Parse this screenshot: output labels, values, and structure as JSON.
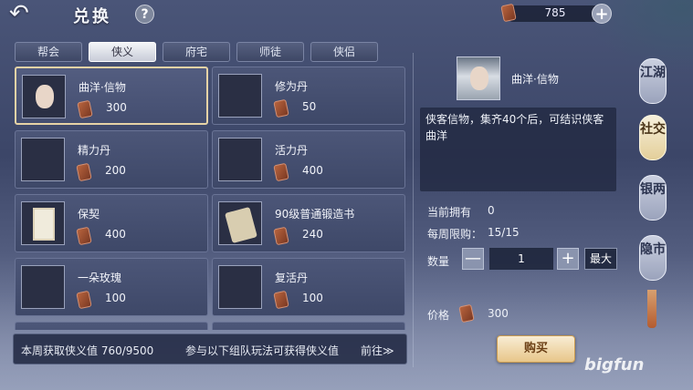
{
  "header": {
    "back_glyph": "↶",
    "title": "兑换",
    "help_glyph": "?",
    "currency_amount": "785",
    "add_glyph": "+"
  },
  "tabs": [
    {
      "label": "帮会",
      "active": false
    },
    {
      "label": "侠义",
      "active": true
    },
    {
      "label": "府宅",
      "active": false
    },
    {
      "label": "师徒",
      "active": false
    },
    {
      "label": "侠侣",
      "active": false
    }
  ],
  "items": [
    {
      "name": "曲洋·信物",
      "price": "300",
      "icon": "portrait-icon",
      "selected": true
    },
    {
      "name": "修为丹",
      "price": "50",
      "icon": "purple-orb-icon"
    },
    {
      "name": "精力丹",
      "price": "200",
      "icon": "red-orb-icon"
    },
    {
      "name": "活力丹",
      "price": "400",
      "icon": "blue-orb-icon"
    },
    {
      "name": "保契",
      "price": "400",
      "icon": "contract-paper-icon"
    },
    {
      "name": "90级普通锻造书",
      "price": "240",
      "icon": "scroll-icon"
    },
    {
      "name": "一朵玫瑰",
      "price": "100",
      "icon": "rose-icon"
    },
    {
      "name": "复活丹",
      "price": "100",
      "icon": "orange-pill-icon"
    }
  ],
  "bottom_bar": {
    "weekly_info": "本周获取侠义值 760/9500",
    "hint": "参与以下组队玩法可获得侠义值",
    "go_label": "前往≫"
  },
  "detail": {
    "name": "曲洋·信物",
    "description": "侠客信物，集齐40个后，可结识侠客曲洋",
    "owned_label": "当前拥有",
    "owned_value": "0",
    "limit_label": "每周限购：",
    "limit_value": "15/15",
    "qty_label": "数量",
    "qty_value": "1",
    "minus_glyph": "—",
    "plus_glyph": "+",
    "max_label": "最大",
    "price_label": "价格",
    "price_value": "300",
    "buy_label": "购买"
  },
  "side_tabs": [
    {
      "label": "江湖",
      "active": false
    },
    {
      "label": "社交",
      "active": true
    },
    {
      "label": "银两",
      "active": false
    },
    {
      "label": "隐市",
      "active": false
    }
  ],
  "watermark": "bigfun",
  "colors": {
    "background": "#3c4668",
    "accent_gold": "#e6d3a6",
    "buy_button": "#e8c68a"
  }
}
